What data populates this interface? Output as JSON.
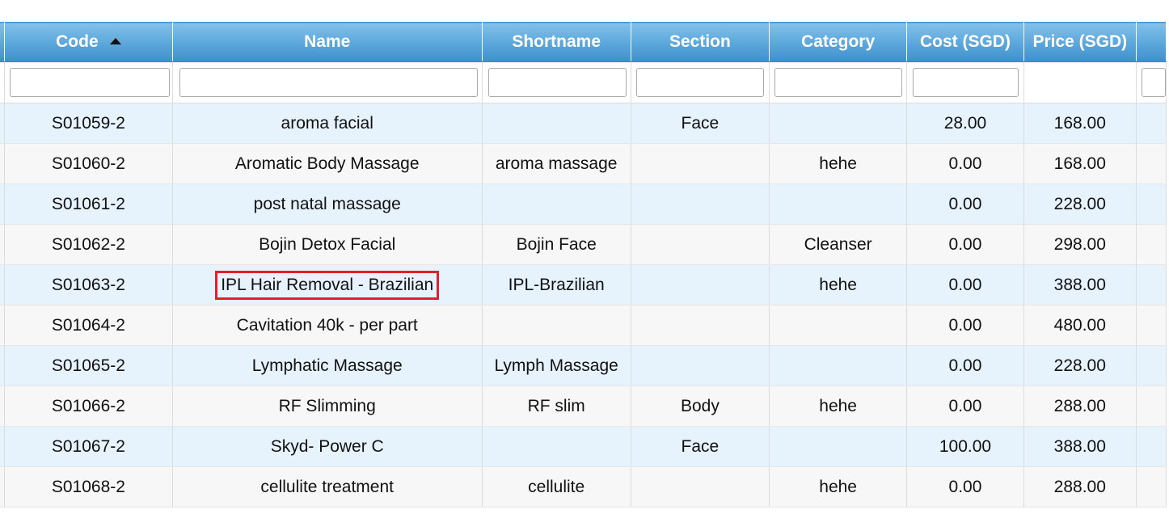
{
  "columns": {
    "code": "Code",
    "name": "Name",
    "shortname": "Shortname",
    "section": "Section",
    "category": "Category",
    "cost": "Cost (SGD)",
    "price": "Price (SGD)"
  },
  "sort": {
    "column": "code",
    "direction": "ascending"
  },
  "filters": {
    "code": "",
    "name": "",
    "shortname": "",
    "section": "",
    "category": "",
    "cost": ""
  },
  "rows": [
    {
      "code": "S01059-2",
      "name": "aroma facial",
      "shortname": "",
      "section": "Face",
      "category": "",
      "cost": "28.00",
      "price": "168.00"
    },
    {
      "code": "S01060-2",
      "name": "Aromatic Body Massage",
      "shortname": "aroma massage",
      "section": "",
      "category": "hehe",
      "cost": "0.00",
      "price": "168.00"
    },
    {
      "code": "S01061-2",
      "name": "post natal massage",
      "shortname": "",
      "section": "",
      "category": "",
      "cost": "0.00",
      "price": "228.00"
    },
    {
      "code": "S01062-2",
      "name": "Bojin Detox Facial",
      "shortname": "Bojin Face",
      "section": "",
      "category": "Cleanser",
      "cost": "0.00",
      "price": "298.00"
    },
    {
      "code": "S01063-2",
      "name": "IPL Hair Removal - Brazilian",
      "shortname": "IPL-Brazilian",
      "section": "",
      "category": "hehe",
      "cost": "0.00",
      "price": "388.00"
    },
    {
      "code": "S01064-2",
      "name": "Cavitation 40k - per part",
      "shortname": "",
      "section": "",
      "category": "",
      "cost": "0.00",
      "price": "480.00"
    },
    {
      "code": "S01065-2",
      "name": "Lymphatic Massage",
      "shortname": "Lymph Massage",
      "section": "",
      "category": "",
      "cost": "0.00",
      "price": "228.00"
    },
    {
      "code": "S01066-2",
      "name": "RF Slimming",
      "shortname": "RF slim",
      "section": "Body",
      "category": "hehe",
      "cost": "0.00",
      "price": "288.00"
    },
    {
      "code": "S01067-2",
      "name": "Skyd- Power C",
      "shortname": "",
      "section": "Face",
      "category": "",
      "cost": "100.00",
      "price": "388.00"
    },
    {
      "code": "S01068-2",
      "name": "cellulite treatment",
      "shortname": "cellulite",
      "section": "",
      "category": "hehe",
      "cost": "0.00",
      "price": "288.00"
    }
  ],
  "highlight": {
    "row_index": 4,
    "column": "name",
    "color": "#e0202a"
  },
  "colors": {
    "header_top": "#82c1ea",
    "header_bottom": "#3f8fcb",
    "row_odd": "#e6f2fc",
    "row_even": "#f7f7f7"
  }
}
